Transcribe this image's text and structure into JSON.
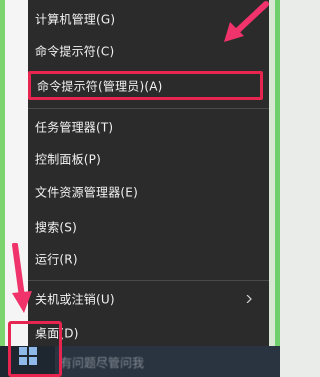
{
  "context_menu": {
    "items": [
      {
        "label": "计算机管理(G)"
      },
      {
        "label": "命令提示符(C)"
      },
      {
        "label": "命令提示符(管理员)(A)"
      },
      {
        "label": "任务管理器(T)"
      },
      {
        "label": "控制面板(P)"
      },
      {
        "label": "文件资源管理器(E)"
      },
      {
        "label": "搜索(S)"
      },
      {
        "label": "运行(R)"
      },
      {
        "label": "关机或注销(U)"
      },
      {
        "label": "桌面(D)"
      }
    ]
  },
  "taskbar": {
    "search_text": "有问题尽管问我"
  },
  "colors": {
    "highlight_border": "#e8254e",
    "arrow": "#f0336a",
    "menu_bg": "#2b2b2b",
    "frame_green": "#7bd46e"
  }
}
